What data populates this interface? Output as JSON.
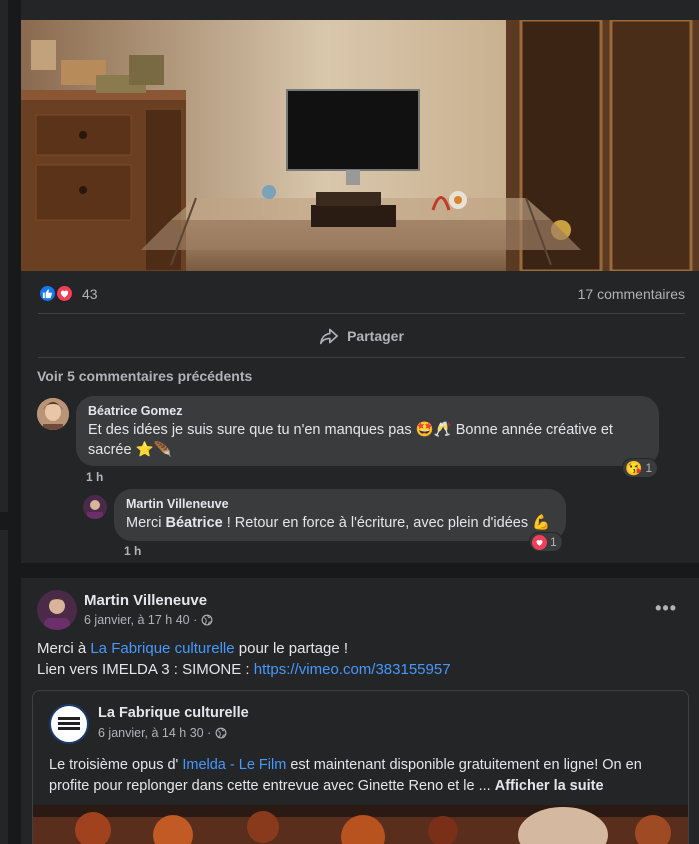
{
  "post1": {
    "reactions_count": "43",
    "comments_count": "17 commentaires",
    "share_label": "Partager",
    "previous_comments_label": "Voir 5 commentaires précédents",
    "comments": [
      {
        "author": "Béatrice Gomez",
        "text_line1": "Et des idées je suis sure que tu n'en manques pas 🤩🥂 Bonne année créative et",
        "text_line2": "sacrée ⭐🪶",
        "time": "1 h",
        "reaction_count": "1"
      },
      {
        "author": "Martin Villeneuve",
        "text_prefix": "Merci ",
        "mention": "Béatrice",
        "text_suffix": " ! Retour en force à l'écriture, avec plein d'idées 💪",
        "time": "1 h",
        "reaction_count": "1"
      }
    ]
  },
  "post2": {
    "author": "Martin Villeneuve",
    "timestamp": "6 janvier, à 17 h 40 ·",
    "line1_prefix": "Merci à ",
    "line1_link": "La Fabrique culturelle",
    "line1_suffix": " pour le partage !",
    "line2_prefix": "Lien vers IMELDA 3 : SIMONE : ",
    "line2_link": "https://vimeo.com/383155957",
    "more_label": "•••",
    "shared": {
      "page_name": "La Fabrique culturelle",
      "timestamp": "6 janvier, à 14 h 30 ·",
      "logo_text": "La Fabrique culturelle",
      "body_prefix": "Le troisième opus d' ",
      "body_link": "Imelda - Le Film",
      "body_rest": " est maintenant disponible gratuitement en ligne! On en profite pour replonger dans cette entrevue avec Ginette Reno et le ... ",
      "see_more": "Afficher la suite"
    }
  },
  "colors": {
    "background": "#18191a",
    "card": "#242526",
    "bubble": "#3a3b3c",
    "link": "#4599ff",
    "like_blue": "#1877f2",
    "love_red": "#f33e58"
  },
  "icons": [
    "like-icon",
    "love-icon",
    "share-icon",
    "globe-icon",
    "more-icon",
    "haha-reaction-icon",
    "love-reaction-icon"
  ]
}
